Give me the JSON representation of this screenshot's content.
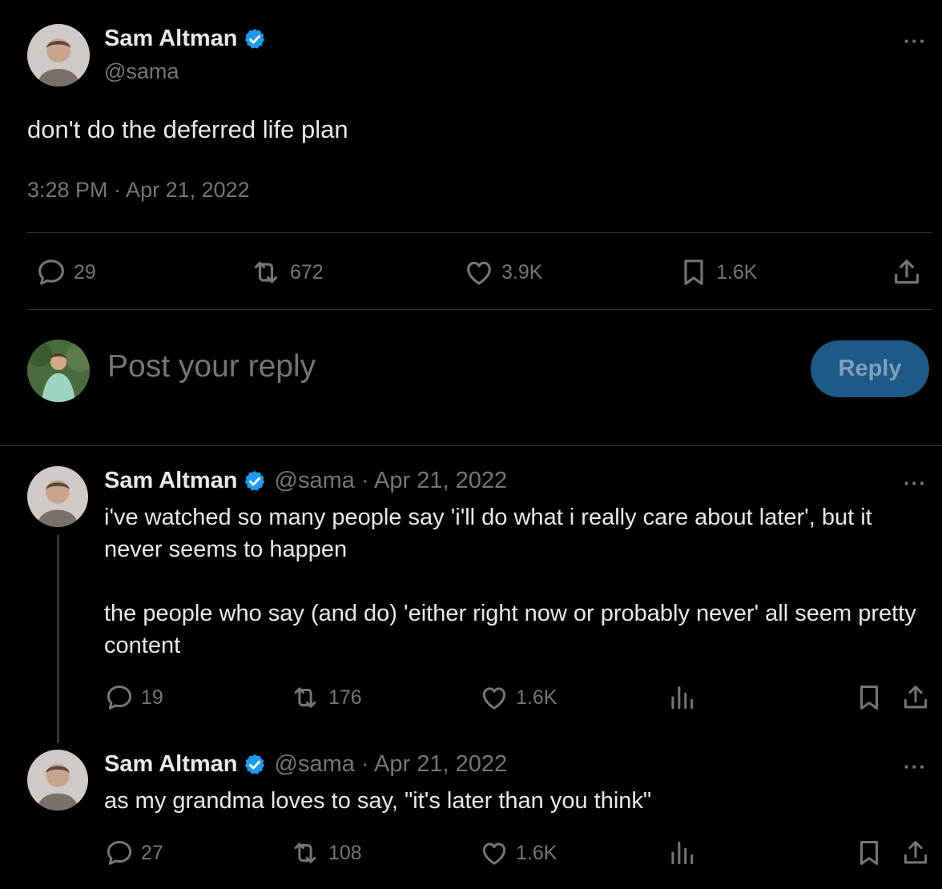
{
  "colors": {
    "background": "#000000",
    "text": "#e7e9ea",
    "muted": "#71767b",
    "verified": "#1d9bf0",
    "reply_button": "#1d5a87",
    "divider": "#2f3336"
  },
  "main_tweet": {
    "author_name": "Sam Altman",
    "handle": "@sama",
    "text": "don't do the deferred life plan",
    "timestamp": "3:28 PM · Apr 21, 2022",
    "more_label": "···",
    "stats": {
      "replies": "29",
      "reposts": "672",
      "likes": "3.9K",
      "bookmarks": "1.6K"
    }
  },
  "composer": {
    "placeholder": "Post your reply",
    "reply_button": "Reply"
  },
  "thread": [
    {
      "author_name": "Sam Altman",
      "handle_date": "@sama · Apr 21, 2022",
      "paragraph_1": "i've watched so many people say 'i'll do what i really care about later', but it never seems to happen",
      "paragraph_2": "the people who say (and do) 'either right now or probably never' all seem pretty content",
      "more_label": "···",
      "stats": {
        "replies": "19",
        "reposts": "176",
        "likes": "1.6K"
      }
    },
    {
      "author_name": "Sam Altman",
      "handle_date": "@sama · Apr 21, 2022",
      "paragraph_1": "as my grandma loves to say, \"it's later than you think\"",
      "more_label": "···",
      "stats": {
        "replies": "27",
        "reposts": "108",
        "likes": "1.6K"
      }
    }
  ],
  "icons": [
    "verified-badge-icon",
    "more-icon",
    "reply-icon",
    "repost-icon",
    "like-icon",
    "bookmark-icon",
    "share-icon",
    "views-icon"
  ]
}
